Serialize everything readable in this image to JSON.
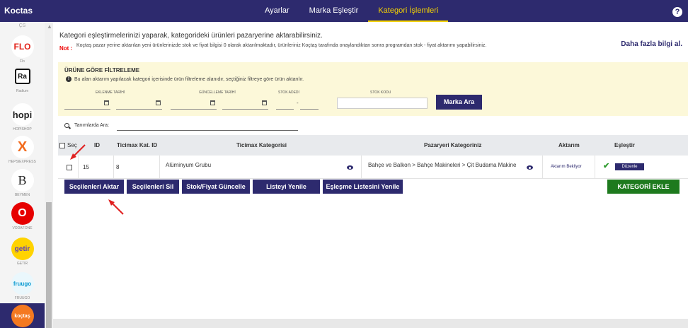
{
  "header": {
    "title": "Koctas",
    "nav": [
      "Ayarlar",
      "Marka Eşleştir",
      "Kategori İşlemleri"
    ],
    "active_nav": "Kategori İşlemleri",
    "help_glyph": "?"
  },
  "sidebar": {
    "partial_top": "ÇS",
    "marketplaces": [
      {
        "logo": "FLO",
        "label": "Flo",
        "color": "#e2231a"
      },
      {
        "logo": "Ra",
        "label": "Radium",
        "color": "#111111"
      },
      {
        "logo": "hopi",
        "label": "HOPISHOP",
        "color": "#222222"
      },
      {
        "logo": "X",
        "label": "HEPSIEXPRESS",
        "color": "#f26b1d"
      },
      {
        "logo": "B",
        "label": "BEYMEN",
        "color": "#222222"
      },
      {
        "logo": "O",
        "label": "VODAFONE",
        "color": "#e60000"
      },
      {
        "logo": "getir",
        "label": "GETIR",
        "color": "#5d3ebc"
      },
      {
        "logo": "fruugo",
        "label": "FRUUGO",
        "color": "#0b9ad1"
      },
      {
        "logo": "koçtaş",
        "label": "",
        "color": "#f47920"
      }
    ]
  },
  "main": {
    "intro": "Kategori eşleştirmelerinizi yaparak, kategorideki ürünleri pazaryerine aktarabilirsiniz.",
    "note_label": "Not :",
    "note_text": "Koçtaş pazar yerine aktarılan yeni ürünlerinizde stok ve fiyat bilgisi 0 olarak aktarılmaktadır, ürünleriniz Koçtaş tarafında onaylandıktan sonra programdan stok - fiyat aktarımı yapabilirsiniz.",
    "more_link": "Daha fazla bilgi al."
  },
  "filter": {
    "title": "ÜRÜNE GÖRE FİLTRELEME",
    "info": "Bu alan aktarım yapılacak kategori içerisinde ürün filtreleme alanıdır, seçtiğiniz filtreye göre ürün aktarılır.",
    "labels": {
      "created": "EKLENME TARİHİ",
      "updated": "GÜNCELLEME TARİHİ",
      "stock_qty": "STOK ADEDİ",
      "stock_code": "STOK KODU"
    },
    "range_separator": "-",
    "button": "Marka Ara"
  },
  "search": {
    "label": "Tanımlarda Ara:",
    "value": ""
  },
  "table": {
    "headers": {
      "select": "Seç",
      "id": "ID",
      "ticimax_cat_id": "Ticimax Kat. ID",
      "ticimax_cat": "Ticimax Kategorisi",
      "marketplace_cat": "Pazaryeri Kategoriniz",
      "transfer": "Aktarım",
      "match": "Eşleştir"
    },
    "rows": [
      {
        "id": "15",
        "ticimax_cat_id": "8",
        "ticimax_cat": "Alüminyum Grubu",
        "marketplace_cat": "Bahçe ve Balkon > Bahçe Makineleri > Çit Budama Makine",
        "transfer": "Aktarım Bekliyor",
        "match_icon": "check-icon",
        "edit": "Düzenle"
      }
    ]
  },
  "actions": [
    "Seçilenleri Aktar",
    "Seçilenleri Sil",
    "Stok/Fiyat Güncelle",
    "Listeyi Yenile",
    "Eşleşme Listesini Yenile"
  ],
  "add_category": "KATEGORİ EKLE",
  "colors": {
    "brand": "#2d2a6e",
    "active_tab": "#f5d300",
    "filter_bg": "#fcf8d9",
    "success": "#1e7a1e",
    "arrow": "#e02020"
  }
}
